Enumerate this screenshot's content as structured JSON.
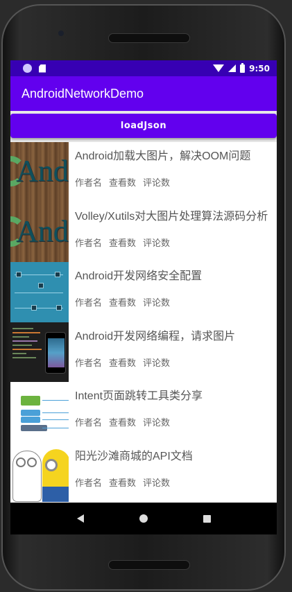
{
  "status_bar": {
    "time": "9:50",
    "icons": [
      "app-circle-icon",
      "sd-card-icon",
      "wifi-icon",
      "signal-icon",
      "battery-icon"
    ]
  },
  "app_bar": {
    "title": "AndroidNetworkDemo"
  },
  "load_button": {
    "label": "loadJson"
  },
  "list": {
    "items": [
      {
        "title": "Android加载大图片，解决OOM问题",
        "author": "作者名",
        "views": "查看数",
        "comments": "评论数",
        "thumb": "android-studio"
      },
      {
        "title": "Volley/Xutils对大图片处理算法源码分析",
        "author": "作者名",
        "views": "查看数",
        "comments": "评论数",
        "thumb": "android-studio"
      },
      {
        "title": "Android开发网络安全配置",
        "author": "作者名",
        "views": "查看数",
        "comments": "评论数",
        "thumb": "network-diagram"
      },
      {
        "title": "Android开发网络编程，请求图片",
        "author": "作者名",
        "views": "查看数",
        "comments": "评论数",
        "thumb": "code-screenshot"
      },
      {
        "title": "Intent页面跳转工具类分享",
        "author": "作者名",
        "views": "查看数",
        "comments": "评论数",
        "thumb": "flow-chart"
      },
      {
        "title": "阳光沙滩商城的API文档",
        "author": "作者名",
        "views": "查看数",
        "comments": "评论数",
        "thumb": "minion"
      }
    ]
  },
  "nav_bar": {
    "icons": [
      "back-icon",
      "home-icon",
      "recents-icon"
    ]
  },
  "colors": {
    "status_bar": "#3700b3",
    "primary": "#6200ee",
    "title_text": "#555555",
    "meta_text": "#666666"
  }
}
